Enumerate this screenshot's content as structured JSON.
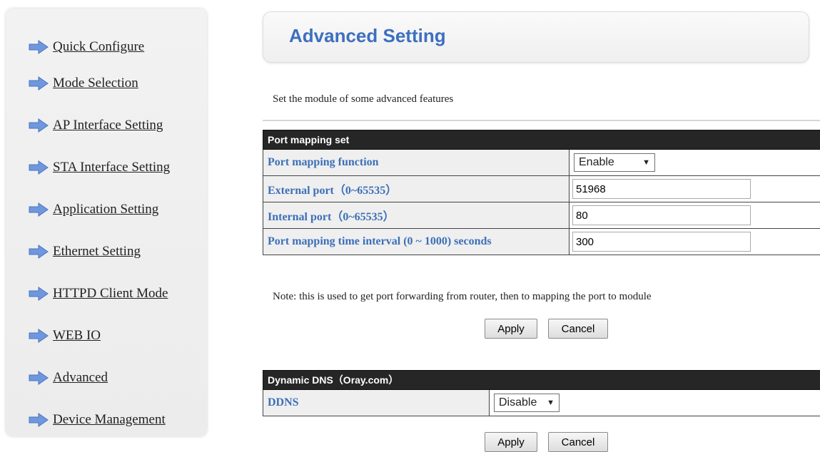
{
  "sidebar": {
    "items": [
      {
        "label": "Quick Configure"
      },
      {
        "label": "Mode Selection"
      },
      {
        "label": "AP Interface Setting"
      },
      {
        "label": "STA Interface Setting"
      },
      {
        "label": "Application Setting"
      },
      {
        "label": "Ethernet Setting"
      },
      {
        "label": "HTTPD Client Mode"
      },
      {
        "label": "WEB IO"
      },
      {
        "label": "Advanced"
      },
      {
        "label": "Device Management"
      }
    ],
    "icon": "arrow-right-icon",
    "icon_color": "#6f97dd"
  },
  "header": {
    "title": "Advanced Setting"
  },
  "intro": "Set the module of some advanced features",
  "port_mapping": {
    "header": "Port mapping set",
    "function_label": "Port mapping function",
    "function_value": "Enable",
    "external_label": "External port（0~65535）",
    "external_value": "51968",
    "internal_label": "Internal port（0~65535）",
    "internal_value": "80",
    "interval_label": "Port mapping time interval (0 ~ 1000) seconds",
    "interval_value": "300",
    "note": "Note: this is used to get port forwarding from router, then to mapping the port to module",
    "apply_label": "Apply",
    "cancel_label": "Cancel"
  },
  "ddns": {
    "header": "Dynamic DNS（Oray.com）",
    "label": "DDNS",
    "value": "Disable",
    "apply_label": "Apply",
    "cancel_label": "Cancel"
  },
  "colors": {
    "accent": "#3d6fbf",
    "label_blue": "#3c6fb8",
    "table_header": "#262626"
  }
}
